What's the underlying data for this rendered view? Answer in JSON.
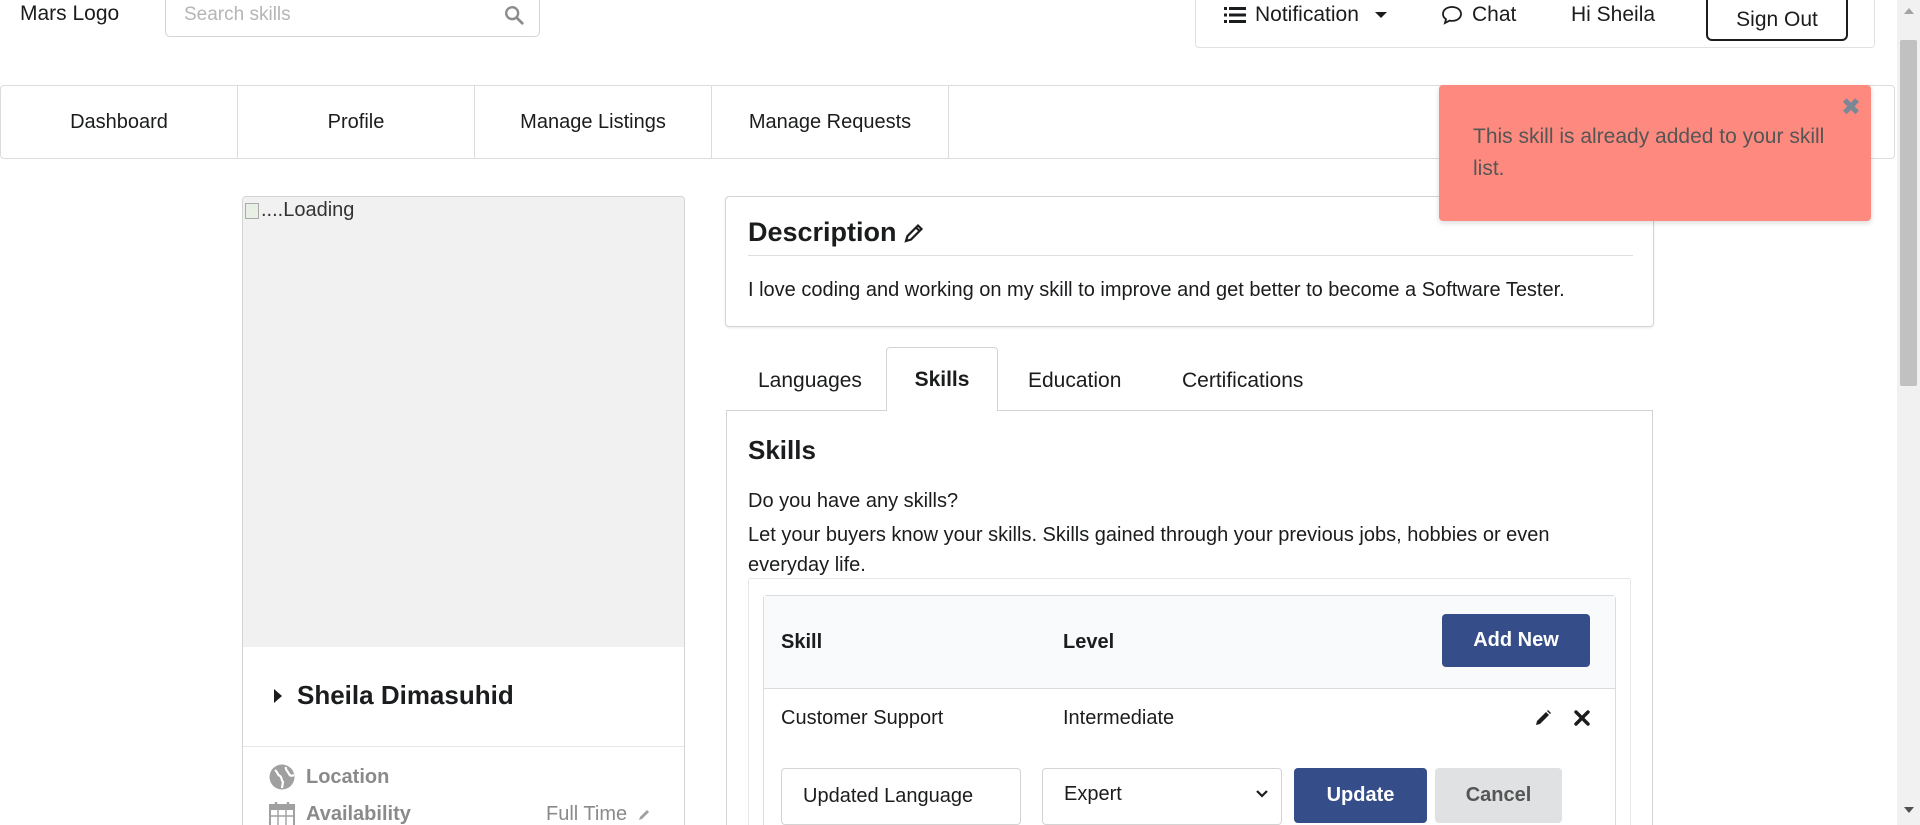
{
  "header": {
    "logo": "Mars Logo",
    "search_placeholder": "Search skills",
    "notification": "Notification",
    "chat": "Chat",
    "greeting": "Hi Sheila",
    "sign_out": "Sign Out"
  },
  "nav": {
    "items": [
      "Dashboard",
      "Profile",
      "Manage Listings",
      "Manage Requests"
    ]
  },
  "toast": {
    "message": "This skill is already added to your skill list.",
    "color": "#fe8a7f"
  },
  "profile": {
    "image_alt": "....Loading",
    "name": "Sheila Dimasuhid",
    "location_label": "Location",
    "availability_label": "Availability",
    "availability_value": "Full Time"
  },
  "description": {
    "title": "Description",
    "text": "I love coding and working on my skill to improve and get better to become a Software Tester."
  },
  "tabs": [
    "Languages",
    "Skills",
    "Education",
    "Certifications"
  ],
  "skills": {
    "title": "Skills",
    "question": "Do you have any skills?",
    "prompt": "Let your buyers know your skills. Skills gained through your previous jobs, hobbies or even everyday life.",
    "columns": [
      "Skill",
      "Level"
    ],
    "add_new": "Add New",
    "rows": [
      {
        "skill": "Customer Support",
        "level": "Intermediate"
      }
    ],
    "edit": {
      "skill_value": "Updated Language",
      "level_value": "Expert",
      "update": "Update",
      "cancel": "Cancel"
    },
    "button_color": "#354d88"
  }
}
